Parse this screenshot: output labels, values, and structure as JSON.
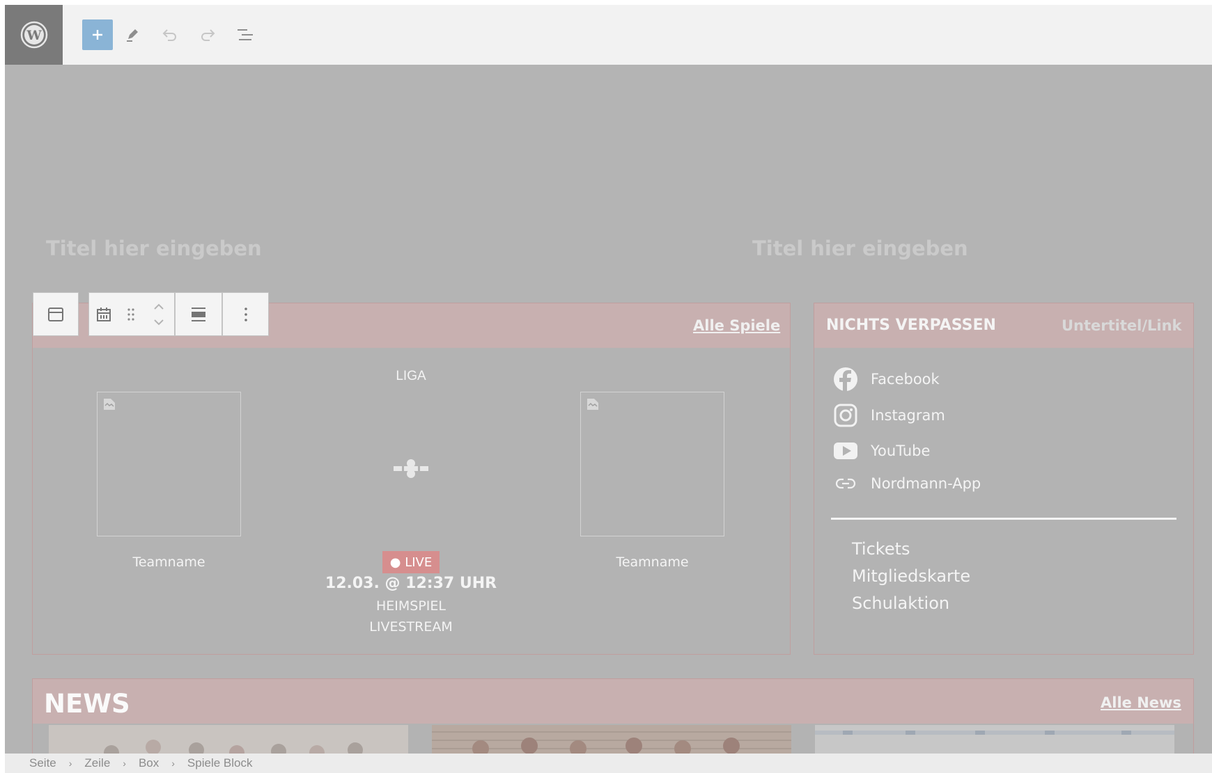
{
  "toolbar": {
    "icons": [
      "wordpress-logo",
      "add-block",
      "edit",
      "undo",
      "redo",
      "document-overview"
    ]
  },
  "titles": [
    "Titel hier eingeben",
    "Titel hier eingeben"
  ],
  "games": {
    "all_link": "Alle Spiele",
    "league": "LIGA",
    "home_team": "Teamname",
    "away_team": "Teamname",
    "live": "● LIVE",
    "date": "12.03. @ 12:37 UHR",
    "type": "HEIMSPIEL",
    "stream": "LIVESTREAM"
  },
  "social": {
    "heading": "NICHTS VERPASSEN",
    "subtitle": "Untertitel/Link",
    "items": [
      "Facebook",
      "Instagram",
      "YouTube",
      "Nordmann-App"
    ],
    "links": [
      "Tickets",
      "Mitgliedskarte",
      "Schulaktion"
    ]
  },
  "news": {
    "heading": "NEWS",
    "all_link": "Alle News"
  },
  "breadcrumb": [
    "Seite",
    "Zeile",
    "Box",
    "Spiele Block"
  ],
  "colors": {
    "canvas": "#b4b4b4",
    "accent_header": "#c8b0b0",
    "live_badge": "#d68e8e",
    "add_button": "#8ab4d6"
  }
}
